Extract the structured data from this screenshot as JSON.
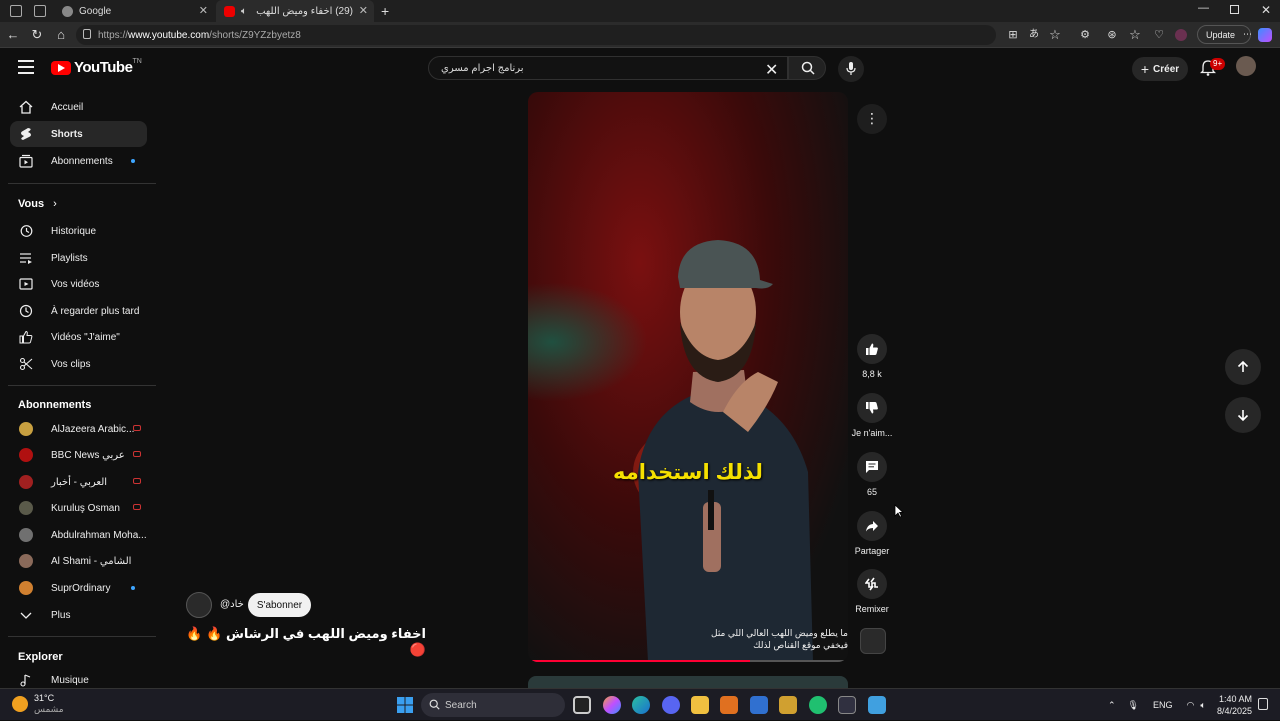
{
  "browser": {
    "tabs": [
      {
        "title": "Google"
      },
      {
        "title": "(29) اخفاء وميض اللهب في الر"
      }
    ],
    "url_prefix": "https://",
    "url_host": "www.youtube.com",
    "url_path": "/shorts/Z9YZzbyetz8",
    "update_label": "Update"
  },
  "header": {
    "logo_text": "YouTube",
    "logo_tm": "TN",
    "search_value": "برنامج اجرام مسري",
    "create_label": "Créer",
    "notifications_badge": "9+"
  },
  "sidebar": {
    "main": [
      {
        "label": "Accueil",
        "icon": "home-icon"
      },
      {
        "label": "Shorts",
        "icon": "shorts-icon"
      },
      {
        "label": "Abonnements",
        "icon": "subscriptions-icon"
      }
    ],
    "you_heading": "Vous",
    "you_items": [
      {
        "label": "Historique",
        "icon": "history-icon"
      },
      {
        "label": "Playlists",
        "icon": "playlists-icon"
      },
      {
        "label": "Vos vidéos",
        "icon": "your-videos-icon"
      },
      {
        "label": "À regarder plus tard",
        "icon": "watch-later-icon"
      },
      {
        "label": "Vidéos \"J'aime\"",
        "icon": "liked-icon"
      },
      {
        "label": "Vos clips",
        "icon": "clips-icon"
      }
    ],
    "subs_heading": "Abonnements",
    "subscriptions": [
      {
        "label": "AlJazeera Arabic...",
        "color": "#c8a040"
      },
      {
        "label": "BBC News عربي",
        "color": "#b01010"
      },
      {
        "label": "العربي - أخبار",
        "color": "#a02020"
      },
      {
        "label": "Kuruluş Osman",
        "color": "#5a5a4a"
      },
      {
        "label": "Abdulrahman Moha...",
        "color": "#707070"
      },
      {
        "label": "Al Shami - الشامي",
        "color": "#8a6a5a"
      },
      {
        "label": "SuprOrdinary",
        "color": "#d08030"
      }
    ],
    "more_label": "Plus",
    "explore_heading": "Explorer",
    "explore_items": [
      {
        "label": "Musique",
        "icon": "music-icon"
      }
    ]
  },
  "short": {
    "caption": "لذلك استخدامه",
    "subtitle_line1": "ما يطلع وميض اللهب العالي اللي مثل",
    "subtitle_line2": "فيخفي موقع القناص لذلك",
    "progress": 0.7,
    "channel_handle": "@خاد",
    "subscribe_label": "S'abonner",
    "title": "اخفاء وميض اللهب في الرشاش 🔥 🔥 🔴"
  },
  "actions": {
    "likes": "8,8 k",
    "dislike_label": "Je n'aim...",
    "comments": "65",
    "share_label": "Partager",
    "remix_label": "Remixer"
  },
  "taskbar": {
    "temperature": "31°C",
    "weather_text": "مشمس",
    "search_placeholder": "Search",
    "language": "ENG",
    "time": "1:40 AM",
    "date": "8/4/2025"
  }
}
